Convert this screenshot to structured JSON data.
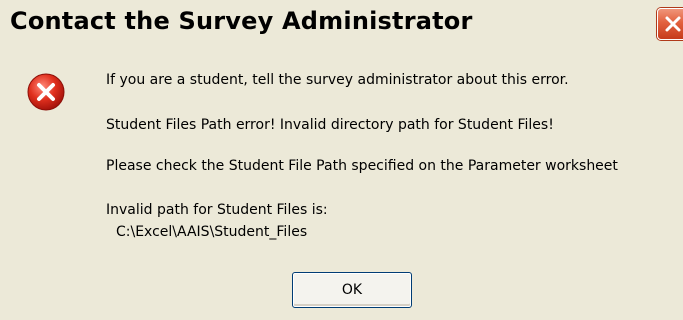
{
  "dialog": {
    "title": "Contact the Survey Administrator",
    "close_icon": "close-icon",
    "error_icon": "error-icon",
    "messages": {
      "line1": "If you are a student, tell the survey administrator about this error.",
      "line2": "Student Files Path error! Invalid directory path for Student Files!",
      "line3": "Please check the Student File Path specified on the Parameter worksheet",
      "line4": "Invalid path for Student Files is:",
      "line5": "C:\\Excel\\AAIS\\Student_Files"
    },
    "ok_label": "OK"
  },
  "colors": {
    "background": "#ece9d8",
    "close_button": "#e2613e",
    "error_icon": "#d7261e"
  }
}
